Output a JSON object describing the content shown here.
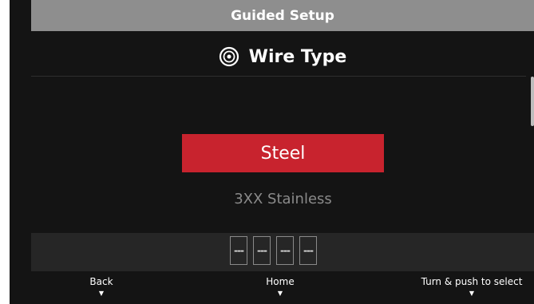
{
  "header": {
    "title": "Guided Setup"
  },
  "page": {
    "heading": "Wire Type",
    "heading_icon": "wire-spool-icon"
  },
  "options": {
    "selected": "Steel",
    "next": "3XX Stainless"
  },
  "fields": [
    "---",
    "---",
    "---",
    "---"
  ],
  "soft_keys": {
    "back": "Back",
    "home": "Home",
    "select": "Turn & push to select"
  },
  "colors": {
    "screen_background": "#141414",
    "title_bar": "#8e8e8e",
    "selection": "#c8232e",
    "field_strip": "#262626",
    "unselected_text": "#8a8a8a"
  }
}
